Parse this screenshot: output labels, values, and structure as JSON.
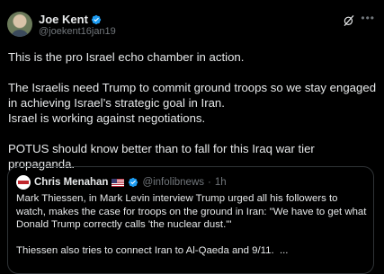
{
  "author": {
    "name": "Joe Kent",
    "handle": "@joekent16jan19",
    "verified": true
  },
  "icons": {
    "verified": "verified-badge-icon",
    "grok": "grok-icon",
    "more": "more-options-icon",
    "flag": "us-flag-icon"
  },
  "colors": {
    "background": "#000000",
    "text": "#e7e9ea",
    "secondary": "#71767b",
    "verified": "#1d9bf0",
    "border": "#2f3336"
  },
  "tweet": {
    "line1": "This is the pro Israel echo chamber in action.",
    "line2": "The Israelis need Trump to commit ground troops so we stay engaged in achieving Israel’s strategic goal in Iran.",
    "line3": "Israel is working against negotiations.",
    "line4": "POTUS should know better than to fall for this Iraq war tier propaganda."
  },
  "quoted_tweet": {
    "name": "Chris Menahan",
    "handle": "@infolibnews",
    "separator": "·",
    "time": "1h",
    "text1": "Mark Thiessen, in Mark Levin interview Trump urged all his followers to watch, makes the case for troops on the ground in Iran: \"We have to get what Donald Trump correctly calls 'the nuclear dust.'\"",
    "text2": "Thiessen also tries to connect Iran to Al-Qaeda and 9/11.  ..."
  }
}
